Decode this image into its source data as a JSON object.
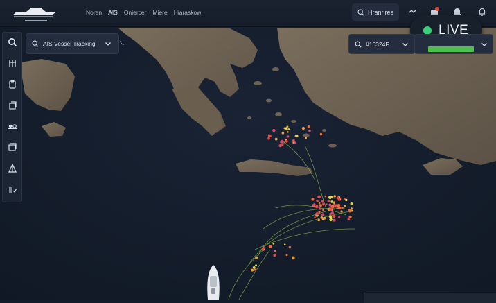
{
  "nav": {
    "items": [
      "Noren",
      "AIS",
      "Oniercer",
      "Miere",
      "Hiaraskow"
    ],
    "active_index": 1
  },
  "search_top": {
    "label": "Hranrires"
  },
  "notification_badge": {
    "color": "#e0453a"
  },
  "live": {
    "label": "LIVE",
    "dot_color": "#39d17a"
  },
  "layer_select": {
    "label": "AIS Vessel Tracking"
  },
  "vessel_id": {
    "label": "#16324F"
  },
  "status_bar": {
    "fill": 0.6,
    "color": "#4cc04b"
  },
  "left_tools": [
    "search-icon",
    "layers-icon",
    "clipboard-icon",
    "stack-icon",
    "settings-icon",
    "copy-icon",
    "sail-icon",
    "filter-icon"
  ],
  "colors": {
    "topbar": "#1a2230",
    "sea": "#131c2a",
    "land": "#6e6252",
    "track": "#7ea34b",
    "panel": "#232d3d"
  }
}
